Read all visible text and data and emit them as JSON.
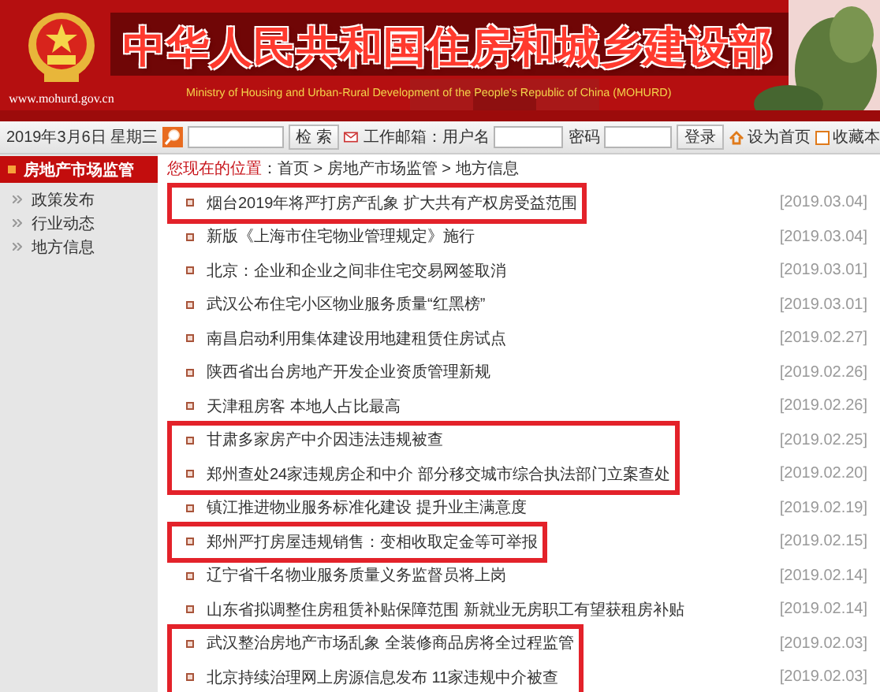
{
  "header": {
    "title": "中华人民共和国住房和城乡建设部",
    "subtitle": "Ministry of Housing and Urban-Rural Development of the People's Republic of China (MOHURD)",
    "url": "www.mohurd.gov.cn"
  },
  "toolbar": {
    "date": "2019年3月6日 星期三",
    "search_button": "检 索",
    "mail_label": "工作邮箱：用户名",
    "password_label": "密码",
    "login_button": "登录",
    "links": [
      {
        "kind": "home",
        "label": "设为首页"
      },
      {
        "kind": "bookmark",
        "label": "收藏本"
      }
    ]
  },
  "sidebar": {
    "title": "房地产市场监管",
    "items": [
      "政策发布",
      "行业动态",
      "地方信息"
    ]
  },
  "breadcrumb": {
    "label": "您现在的位置",
    "path": "：首页 > 房地产市场监管 > 地方信息"
  },
  "news_groups": [
    {
      "highlighted": true,
      "items": [
        {
          "title": "烟台2019年将严打房产乱象 扩大共有产权房受益范围",
          "date": "[2019.03.04]"
        }
      ]
    },
    {
      "highlighted": false,
      "items": [
        {
          "title": "新版《上海市住宅物业管理规定》施行",
          "date": "[2019.03.04]"
        },
        {
          "title": "北京：企业和企业之间非住宅交易网签取消",
          "date": "[2019.03.01]"
        },
        {
          "title": "武汉公布住宅小区物业服务质量“红黑榜”",
          "date": "[2019.03.01]"
        },
        {
          "title": "南昌启动利用集体建设用地建租赁住房试点",
          "date": "[2019.02.27]"
        },
        {
          "title": "陕西省出台房地产开发企业资质管理新规",
          "date": "[2019.02.26]"
        },
        {
          "title": "天津租房客 本地人占比最高",
          "date": "[2019.02.26]"
        }
      ]
    },
    {
      "highlighted": true,
      "items": [
        {
          "title": "甘肃多家房产中介因违法违规被查",
          "date": "[2019.02.25]"
        },
        {
          "title": "郑州查处24家违规房企和中介 部分移交城市综合执法部门立案查处",
          "date": "[2019.02.20]"
        }
      ]
    },
    {
      "highlighted": false,
      "items": [
        {
          "title": "镇江推进物业服务标准化建设  提升业主满意度",
          "date": "[2019.02.19]"
        }
      ]
    },
    {
      "highlighted": true,
      "items": [
        {
          "title": "郑州严打房屋违规销售：变相收取定金等可举报",
          "date": "[2019.02.15]"
        }
      ]
    },
    {
      "highlighted": false,
      "items": [
        {
          "title": "辽宁省千名物业服务质量义务监督员将上岗",
          "date": "[2019.02.14]"
        },
        {
          "title": "山东省拟调整住房租赁补贴保障范围  新就业无房职工有望获租房补贴",
          "date": "[2019.02.14]"
        }
      ]
    },
    {
      "highlighted": true,
      "items": [
        {
          "title": "武汉整治房地产市场乱象  全装修商品房将全过程监管",
          "date": "[2019.02.03]"
        },
        {
          "title": "北京持续治理网上房源信息发布  11家违规中介被查",
          "date": "[2019.02.03]"
        }
      ]
    }
  ]
}
